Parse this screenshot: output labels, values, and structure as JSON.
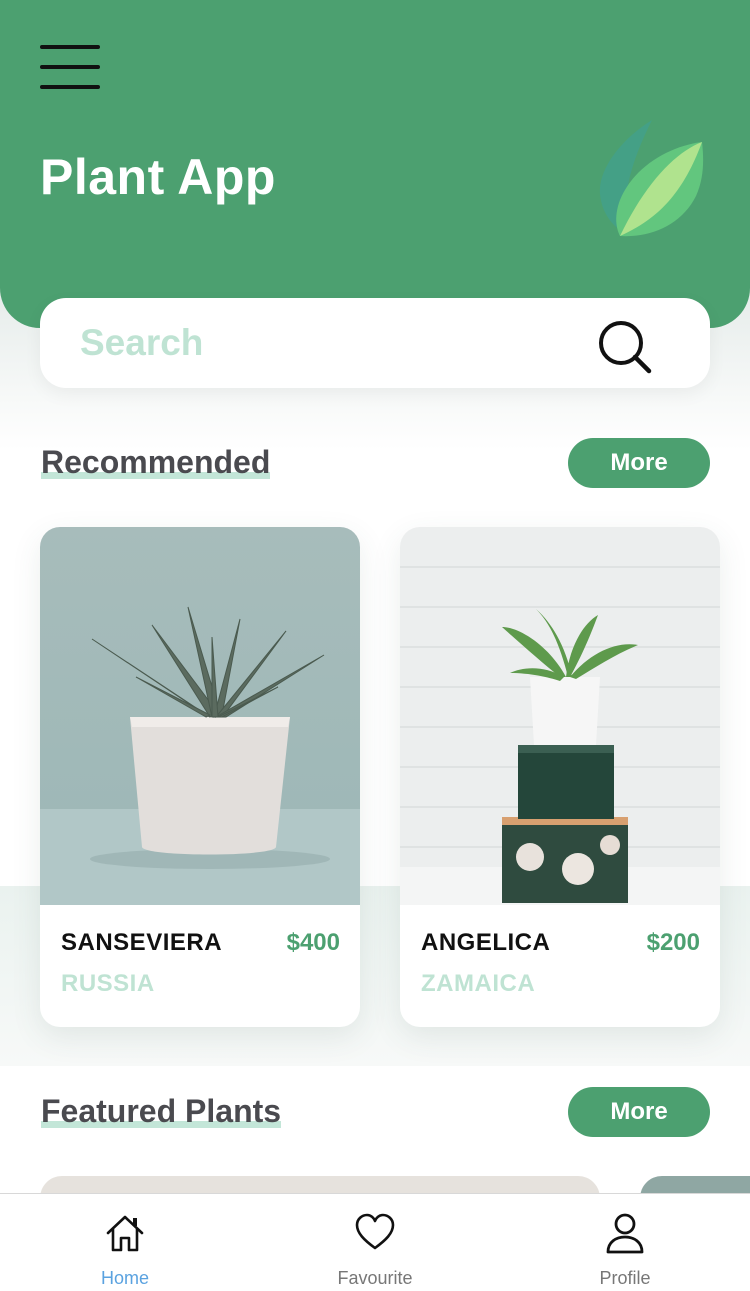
{
  "header": {
    "title": "Plant App",
    "menu_icon": "hamburger-menu-icon",
    "logo_icon": "leaf-logo-icon",
    "accent_color": "#4ca070"
  },
  "search": {
    "placeholder": "Search",
    "value": "",
    "icon": "search-icon"
  },
  "recommended": {
    "title": "Recommended",
    "more_label": "More",
    "items": [
      {
        "name": "SANSEVIERA",
        "price": "$400",
        "country": "RUSSIA"
      },
      {
        "name": "ANGELICA",
        "price": "$200",
        "country": "ZAMAICA"
      }
    ]
  },
  "featured": {
    "title": "Featured Plants",
    "more_label": "More"
  },
  "bottom_nav": {
    "items": [
      {
        "label": "Home",
        "icon": "home-icon",
        "active": true
      },
      {
        "label": "Favourite",
        "icon": "heart-icon",
        "active": false
      },
      {
        "label": "Profile",
        "icon": "user-icon",
        "active": false
      }
    ]
  }
}
